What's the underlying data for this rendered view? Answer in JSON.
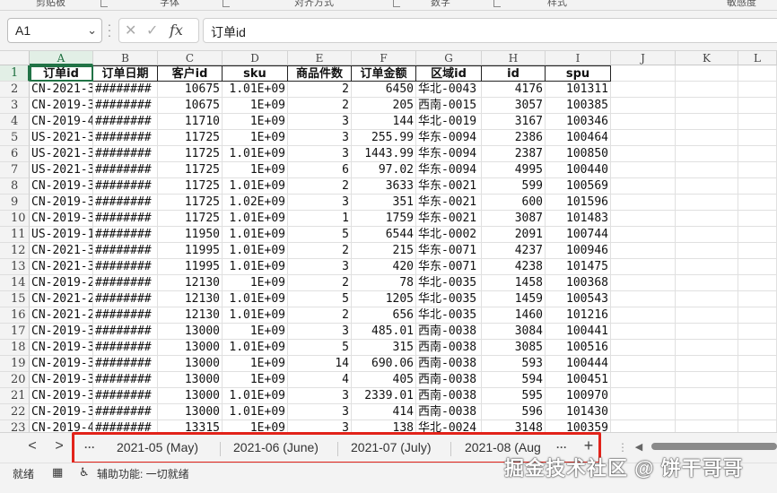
{
  "ribbon": {
    "groups": [
      "剪贴板",
      "字体",
      "对齐方式",
      "数字",
      "样式",
      "敏感度"
    ]
  },
  "formula_bar": {
    "name_box": "A1",
    "name_box_caret": "⌄",
    "formula": "订单id",
    "icons": {
      "cancel": "✕",
      "enter": "✓",
      "fx": "fx"
    }
  },
  "columns": [
    "A",
    "B",
    "C",
    "D",
    "E",
    "F",
    "G",
    "H",
    "I",
    "J",
    "K",
    "L"
  ],
  "header_row": [
    "订单id",
    "订单日期",
    "客户id",
    "sku",
    "商品件数",
    "订单金额",
    "区域id",
    "id",
    "spu"
  ],
  "rows": [
    [
      "CN-2021-3",
      "########",
      "10675",
      "1.01E+09",
      "2",
      "6450",
      "华北-0043",
      "4176",
      "101311"
    ],
    [
      "CN-2019-3",
      "########",
      "10675",
      "1E+09",
      "2",
      "205",
      "西南-0015",
      "3057",
      "100385"
    ],
    [
      "CN-2019-4",
      "########",
      "11710",
      "1E+09",
      "3",
      "144",
      "华北-0019",
      "3167",
      "100346"
    ],
    [
      "US-2021-3",
      "########",
      "11725",
      "1E+09",
      "3",
      "255.99",
      "华东-0094",
      "2386",
      "100464"
    ],
    [
      "US-2021-3",
      "########",
      "11725",
      "1.01E+09",
      "3",
      "1443.99",
      "华东-0094",
      "2387",
      "100850"
    ],
    [
      "US-2021-3",
      "########",
      "11725",
      "1E+09",
      "6",
      "97.02",
      "华东-0094",
      "4995",
      "100440"
    ],
    [
      "CN-2019-3",
      "########",
      "11725",
      "1.01E+09",
      "2",
      "3633",
      "华东-0021",
      "599",
      "100569"
    ],
    [
      "CN-2019-3",
      "########",
      "11725",
      "1.02E+09",
      "3",
      "351",
      "华东-0021",
      "600",
      "101596"
    ],
    [
      "CN-2019-3",
      "########",
      "11725",
      "1.01E+09",
      "1",
      "1759",
      "华东-0021",
      "3087",
      "101483"
    ],
    [
      "US-2019-1",
      "########",
      "11950",
      "1.01E+09",
      "5",
      "6544",
      "华北-0002",
      "2091",
      "100744"
    ],
    [
      "CN-2021-3",
      "########",
      "11995",
      "1.01E+09",
      "2",
      "215",
      "华东-0071",
      "4237",
      "100946"
    ],
    [
      "CN-2021-3",
      "########",
      "11995",
      "1.01E+09",
      "3",
      "420",
      "华东-0071",
      "4238",
      "101475"
    ],
    [
      "CN-2019-2",
      "########",
      "12130",
      "1E+09",
      "2",
      "78",
      "华北-0035",
      "1458",
      "100368"
    ],
    [
      "CN-2021-2",
      "########",
      "12130",
      "1.01E+09",
      "5",
      "1205",
      "华北-0035",
      "1459",
      "100543"
    ],
    [
      "CN-2021-2",
      "########",
      "12130",
      "1.01E+09",
      "2",
      "656",
      "华北-0035",
      "1460",
      "101216"
    ],
    [
      "CN-2019-3",
      "########",
      "13000",
      "1E+09",
      "3",
      "485.01",
      "西南-0038",
      "3084",
      "100441"
    ],
    [
      "CN-2019-3",
      "########",
      "13000",
      "1.01E+09",
      "5",
      "315",
      "西南-0038",
      "3085",
      "100516"
    ],
    [
      "CN-2019-3",
      "########",
      "13000",
      "1E+09",
      "14",
      "690.06",
      "西南-0038",
      "593",
      "100444"
    ],
    [
      "CN-2019-3",
      "########",
      "13000",
      "1E+09",
      "4",
      "405",
      "西南-0038",
      "594",
      "100451"
    ],
    [
      "CN-2019-3",
      "########",
      "13000",
      "1.01E+09",
      "3",
      "2339.01",
      "西南-0038",
      "595",
      "100970"
    ],
    [
      "CN-2019-3",
      "########",
      "13000",
      "1.01E+09",
      "3",
      "414",
      "西南-0038",
      "596",
      "101430"
    ],
    [
      "CN-2019-4",
      "########",
      "13315",
      "1E+09",
      "3",
      "138",
      "华北-0024",
      "3148",
      "100359"
    ]
  ],
  "tabs": {
    "prev": "<",
    "next": ">",
    "more_left": "···",
    "more_right": "···",
    "add": "+",
    "items": [
      "2021-05 (May)",
      "2021-06 (June)",
      "2021-07 (July)",
      "2021-08 (Aug"
    ]
  },
  "status": {
    "ready": "就绪",
    "accessibility": "辅助功能: 一切就绪"
  },
  "watermark": "掘金技术社区 @ 饼干哥哥"
}
